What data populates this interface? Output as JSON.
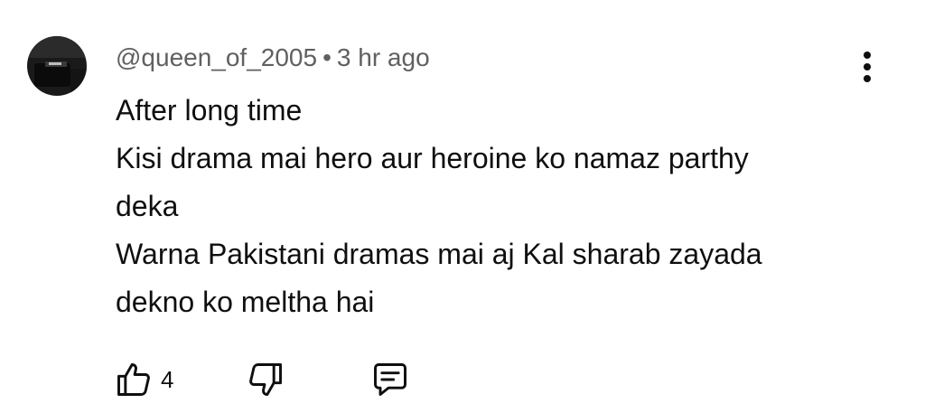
{
  "comment": {
    "username": "@queen_of_2005",
    "separator": "•",
    "time": "3 hr ago",
    "lines": [
      "After long time",
      "Kisi drama mai hero aur heroine ko namaz parthy",
      "deka",
      "Warna Pakistani dramas mai aj Kal sharab zayada",
      "dekno ko meltha hai"
    ],
    "like_count": "4"
  },
  "icons": {
    "avatar": "avatar-dark-thumbnail",
    "more": "vertical-dots-icon",
    "like": "thumbs-up-icon",
    "dislike": "thumbs-down-icon",
    "reply": "comment-bubble-icon"
  },
  "colors": {
    "text": "#0f0f0f",
    "meta": "#606060",
    "background": "#ffffff"
  }
}
